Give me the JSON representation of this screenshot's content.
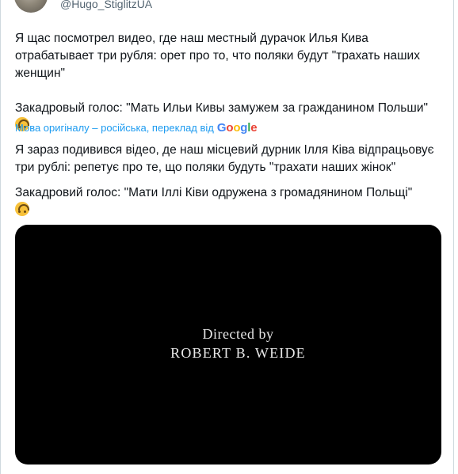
{
  "tweet": {
    "handle": "@Hugo_StiglitzUA",
    "original": {
      "paragraph1": "Я щас посмотрел видео, где наш местный дурачок Илья Кива отрабатывает три рубля: орет про то, что поляки будут \"трахать наших женщин\"",
      "paragraph2": "Закадровый голос: \"Мать Ильи Кивы замужем за гражданином Польши\"",
      "emoji": "upside-down-face"
    },
    "translation_note": {
      "text": "Мова оригіналу – російська, переклад від",
      "provider": "Google"
    },
    "translated": {
      "paragraph1": "Я зараз подивився відео, де наш місцевий дурник Ілля Ківа відпрацьовує три рублі: репетує про те, що поляки будуть \"трахати наших жінок\"",
      "paragraph2": "Закадровий голос: \"Мати Іллі Ківи одружена з громадянином Польщі\"",
      "emoji": "upside-down-face"
    },
    "media": {
      "type": "video",
      "caption_line1": "Directed by",
      "caption_line2": "ROBERT B. WEIDE",
      "background": "#000000"
    }
  },
  "colors": {
    "text": "#0f1419",
    "secondary": "#536471",
    "link": "#1d9bf0",
    "border": "#cfd9de"
  }
}
